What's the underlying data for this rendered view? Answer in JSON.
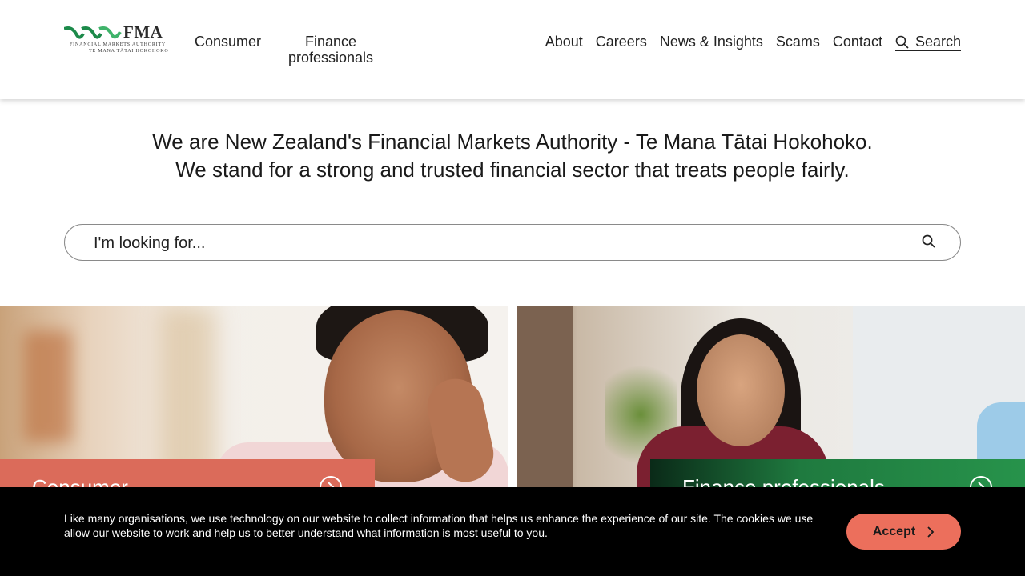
{
  "header": {
    "logo": {
      "abbrev": "FMA",
      "line1": "FINANCIAL MARKETS AUTHORITY",
      "line2": "TE MANA TĀTAI HOKOHOKO",
      "colors": {
        "wave_dark": "#1c8a4a",
        "wave_light": "#3fb36a"
      }
    },
    "nav_primary": [
      {
        "label": "Consumer"
      },
      {
        "label": "Finance\nprofessionals"
      }
    ],
    "nav_secondary": [
      {
        "label": "About"
      },
      {
        "label": "Careers"
      },
      {
        "label": "News & Insights"
      },
      {
        "label": "Scams"
      },
      {
        "label": "Contact"
      }
    ],
    "search_label": "Search",
    "search_icon": "search-icon"
  },
  "intro": {
    "line1": "We are New Zealand's Financial Markets Authority - Te Mana Tātai Hokohoko.",
    "line2": "We stand for a strong and trusted financial sector that treats people fairly."
  },
  "search": {
    "placeholder": "I'm looking for...",
    "value": "",
    "icon": "search-icon"
  },
  "cards": [
    {
      "label": "Consumer",
      "color": "#db6b5a",
      "icon": "arrow-circle-icon"
    },
    {
      "label": "Finance professionals",
      "color": "#27934b",
      "icon": "arrow-circle-icon"
    }
  ],
  "cookie_banner": {
    "text": "Like many organisations, we use technology on our website to collect information that helps us enhance the experience of our site. The cookies we use allow our website to work and help us to better understand what information is most useful to you.",
    "accept_label": "Accept",
    "accept_color": "#ec6f5c"
  }
}
